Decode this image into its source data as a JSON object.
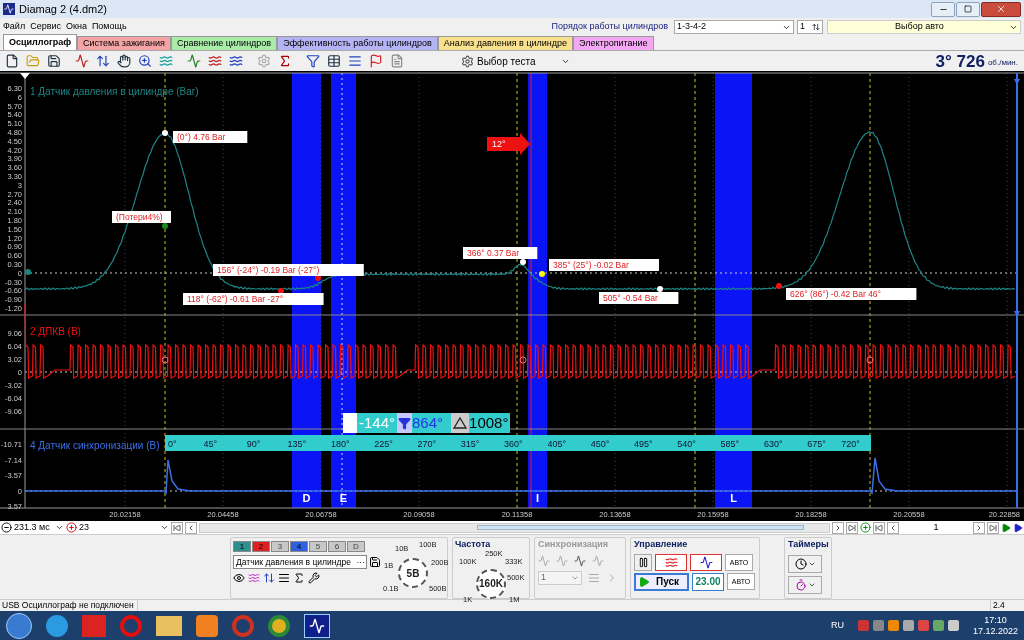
{
  "window": {
    "title": "Diamag 2 (4.dm2)"
  },
  "menu": [
    "Файл",
    "Сервис",
    "Окна",
    "Помощь"
  ],
  "header": {
    "cylinder_order_label": "Порядок работы цилиндров",
    "cylinder_order": "1-3-4-2",
    "cylinder": "1",
    "car_select": "Выбор авто"
  },
  "tabs": [
    {
      "label": "Осциллограф",
      "selected": true,
      "color": "#ffffff"
    },
    {
      "label": "Система зажигания",
      "selected": false,
      "color": "#f4a4a4"
    },
    {
      "label": "Сравнение цилиндров",
      "selected": false,
      "color": "#a8eca8"
    },
    {
      "label": "Эффективность работы цилиндров",
      "selected": false,
      "color": "#b4b4f4"
    },
    {
      "label": "Анализ давления в цилиндре",
      "selected": false,
      "color": "#f8e08c"
    },
    {
      "label": "Электропитание",
      "selected": false,
      "color": "#f4a8f4"
    }
  ],
  "toolbar": {
    "test_select": "Выбор теста",
    "rpm_value": "3° 726",
    "rpm_unit": "об./мин."
  },
  "scope": {
    "channels": [
      {
        "kind": "pressure",
        "title": "1 Датчик давления в цилиндре (Bar)",
        "color": "#1e8585",
        "yticks": [
          "6.30",
          "6",
          "5.70",
          "5.40",
          "5.10",
          "4.80",
          "4.50",
          "4.20",
          "3.90",
          "3.60",
          "3.30",
          "3",
          "2.70",
          "2.40",
          "2.10",
          "1.80",
          "1.50",
          "1.20",
          "0.90",
          "0.60",
          "0.30",
          "0",
          "-0.30",
          "-0.60",
          "-0.90",
          "-1.20"
        ]
      },
      {
        "kind": "square",
        "title": "2 ДПКВ (В)",
        "color": "#ee1111",
        "yticks": [
          "9.06",
          "6.04",
          "3.02",
          "0",
          "-3.02",
          "-6.04",
          "-9.06"
        ]
      },
      {
        "kind": "sync",
        "title": "4 Датчик синхронизации (В)",
        "color": "#3a6ee8",
        "yticks": [
          "-10.71",
          "-7.14",
          "-3.57",
          "0",
          "3.57"
        ]
      }
    ],
    "markers": [
      {
        "text": "(0°) 4.76 Bar",
        "color": "#ffffff"
      },
      {
        "text": "(Потери4%)",
        "color": "#1a8a1a"
      },
      {
        "text": "156° (-24°) -0.19 Bar (-27°)",
        "color": "#ee1111"
      },
      {
        "text": "118° (-62°) -0.61 Bar -27°",
        "color": "#ee1111"
      },
      {
        "text": "366° 0.37 Bar",
        "color": "#ffffff"
      },
      {
        "text": "385° (25°) -0.02 Bar",
        "color": "#ffff00"
      },
      {
        "text": "505° -0.54 Bar",
        "color": "#ffffff"
      },
      {
        "text": "626° (86°) -0.42 Bar 46°",
        "color": "#ee1111"
      }
    ],
    "arrow_label": "12°",
    "zones": [
      {
        "label": "D"
      },
      {
        "label": "E"
      },
      {
        "label": "I"
      },
      {
        "label": "L"
      }
    ],
    "cursor": {
      "start": "-144°",
      "end": "864°",
      "delta": "1008°"
    },
    "degree_ticks": [
      "0°",
      "45°",
      "90°",
      "135°",
      "180°",
      "225°",
      "270°",
      "315°",
      "360°",
      "405°",
      "450°",
      "495°",
      "540°",
      "585°",
      "630°",
      "675°",
      "720°"
    ],
    "time_ticks": [
      "20.02158",
      "20.04458",
      "20.06758",
      "20.09058",
      "20.11358",
      "20.13658",
      "20.15958",
      "20.18258",
      "20.20558",
      "20.22858"
    ]
  },
  "navigation": {
    "timebase": "231.3 мс",
    "zoom": "23",
    "page": "1"
  },
  "controls": {
    "channel_buttons": [
      {
        "label": "1",
        "color": "#2e8f8f",
        "disabled": false
      },
      {
        "label": "2",
        "color": "#e02020",
        "disabled": false
      },
      {
        "label": "3",
        "color": "#c8c8c8",
        "disabled": true
      },
      {
        "label": "4",
        "color": "#3060e0",
        "disabled": false
      },
      {
        "label": "5",
        "color": "#c8c8c8",
        "disabled": true
      },
      {
        "label": "6",
        "color": "#c8c8c8",
        "disabled": true
      },
      {
        "label": "D",
        "color": "#c8c8c8",
        "disabled": true
      }
    ],
    "channel_select": "Датчик давления в цилиндре",
    "more": "···",
    "volt_knob": {
      "labels": [
        "10В",
        "100В",
        "1В",
        "200В",
        "0.1В",
        "500В"
      ],
      "value": "5В"
    },
    "frequency": {
      "title": "Частота",
      "labels": [
        "250K",
        "100K",
        "333K",
        "500K",
        "1K",
        "1M"
      ],
      "value": "160K"
    },
    "sync": {
      "title": "Синхронизация",
      "select": "1"
    },
    "control": {
      "title": "Управление",
      "start": "Пуск",
      "time": "23.00",
      "auto": [
        "АВТО",
        "АВТО"
      ]
    },
    "timers": {
      "title": "Таймеры"
    }
  },
  "status_bar": [
    "USB Осциллограф не подключен",
    "2.4"
  ],
  "taskbar": {
    "lang": "RU",
    "time": "17:10",
    "date": "17.12.2022"
  }
}
